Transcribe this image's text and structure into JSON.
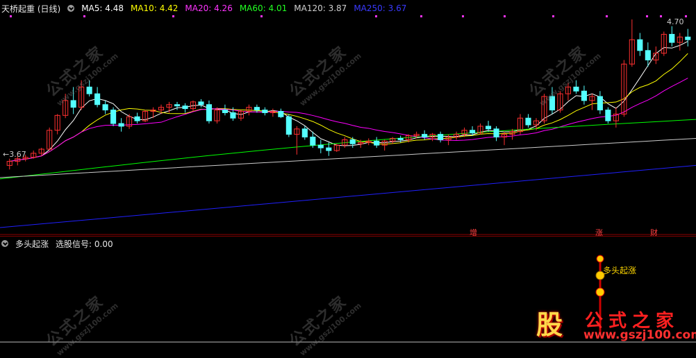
{
  "main_header": {
    "indicator_name": "天桥起重 (日线)",
    "ma5_label": "MA5:",
    "ma5_value": "4.48",
    "ma10_label": "MA10:",
    "ma10_value": "4.42",
    "ma20_label": "MA20:",
    "ma20_value": "4.26",
    "ma60_label": "MA60:",
    "ma60_value": "4.01",
    "ma120_label": "MA120:",
    "ma120_value": "3.87",
    "ma250_label": "MA250:",
    "ma250_value": "3.67"
  },
  "colors": {
    "ma5": "#ffffff",
    "ma10": "#ffff00",
    "ma20": "#ff00ff",
    "ma60": "#00ff00",
    "ma120": "#cccccc",
    "ma250": "#2020ff",
    "up": "#ff3030",
    "down": "#54ffff",
    "separator": "#8b0000",
    "marker": "#ff33ff"
  },
  "price_labels": {
    "high": "4.70",
    "low": "3.67"
  },
  "event_markers": [
    "增",
    "涨",
    "财"
  ],
  "sub_header": {
    "indicator_name": "多头起涨",
    "signal_label": "选股信号:",
    "signal_value": "0.00"
  },
  "signal_annotation": "多头起涨",
  "watermark": {
    "text": "公式之家",
    "url": "www.gszj100.com"
  },
  "brand": {
    "logo_char": "股",
    "name": "公式之家",
    "url": "www.gszj100.com"
  },
  "chart_data": {
    "type": "candlestick",
    "price_range": [
      3.2,
      4.75
    ],
    "candles": [
      [
        3.67,
        3.72,
        3.64,
        3.7
      ],
      [
        3.7,
        3.74,
        3.67,
        3.72
      ],
      [
        3.72,
        3.75,
        3.7,
        3.73
      ],
      [
        3.73,
        3.78,
        3.72,
        3.76
      ],
      [
        3.76,
        3.8,
        3.74,
        3.79
      ],
      [
        3.79,
        3.95,
        3.78,
        3.93
      ],
      [
        3.93,
        4.05,
        3.9,
        4.04
      ],
      [
        4.04,
        4.2,
        4.02,
        4.15
      ],
      [
        4.15,
        4.25,
        4.05,
        4.1
      ],
      [
        4.1,
        4.3,
        4.08,
        4.25
      ],
      [
        4.25,
        4.3,
        4.18,
        4.2
      ],
      [
        4.2,
        4.25,
        4.1,
        4.12
      ],
      [
        4.12,
        4.15,
        4.05,
        4.08
      ],
      [
        4.08,
        4.1,
        3.96,
        3.98
      ],
      [
        3.98,
        4.02,
        3.92,
        3.96
      ],
      [
        3.96,
        4.05,
        3.94,
        4.03
      ],
      [
        4.03,
        4.06,
        3.98,
        4.0
      ],
      [
        4.0,
        4.08,
        3.99,
        4.07
      ],
      [
        4.07,
        4.1,
        4.02,
        4.08
      ],
      [
        4.08,
        4.12,
        4.05,
        4.1
      ],
      [
        4.1,
        4.14,
        4.06,
        4.12
      ],
      [
        4.12,
        4.14,
        4.08,
        4.11
      ],
      [
        4.11,
        4.13,
        4.06,
        4.09
      ],
      [
        4.09,
        4.15,
        4.07,
        4.14
      ],
      [
        4.14,
        4.16,
        4.1,
        4.12
      ],
      [
        4.12,
        4.15,
        3.98,
        4.0
      ],
      [
        4.0,
        4.1,
        3.98,
        4.08
      ],
      [
        4.08,
        4.12,
        4.04,
        4.06
      ],
      [
        4.06,
        4.1,
        4.0,
        4.02
      ],
      [
        4.02,
        4.08,
        4.0,
        4.07
      ],
      [
        4.07,
        4.12,
        4.04,
        4.1
      ],
      [
        4.1,
        4.12,
        4.06,
        4.08
      ],
      [
        4.08,
        4.1,
        4.04,
        4.06
      ],
      [
        4.06,
        4.09,
        4.03,
        4.07
      ],
      [
        4.07,
        4.09,
        4.02,
        4.03
      ],
      [
        4.03,
        4.05,
        3.88,
        3.9
      ],
      [
        3.9,
        3.96,
        3.75,
        3.94
      ],
      [
        3.94,
        3.96,
        3.86,
        3.88
      ],
      [
        3.88,
        3.92,
        3.8,
        3.82
      ],
      [
        3.82,
        3.86,
        3.76,
        3.8
      ],
      [
        3.8,
        3.84,
        3.74,
        3.78
      ],
      [
        3.78,
        3.83,
        3.77,
        3.82
      ],
      [
        3.82,
        3.88,
        3.8,
        3.86
      ],
      [
        3.86,
        3.88,
        3.8,
        3.83
      ],
      [
        3.83,
        3.86,
        3.8,
        3.84
      ],
      [
        3.84,
        3.87,
        3.82,
        3.85
      ],
      [
        3.85,
        3.88,
        3.8,
        3.82
      ],
      [
        3.82,
        3.86,
        3.78,
        3.85
      ],
      [
        3.85,
        3.88,
        3.83,
        3.87
      ],
      [
        3.87,
        3.89,
        3.84,
        3.86
      ],
      [
        3.86,
        3.9,
        3.84,
        3.89
      ],
      [
        3.89,
        3.92,
        3.87,
        3.9
      ],
      [
        3.9,
        3.93,
        3.86,
        3.88
      ],
      [
        3.88,
        3.91,
        3.85,
        3.9
      ],
      [
        3.9,
        3.92,
        3.84,
        3.86
      ],
      [
        3.86,
        3.9,
        3.82,
        3.88
      ],
      [
        3.88,
        3.92,
        3.86,
        3.9
      ],
      [
        3.9,
        3.95,
        3.88,
        3.93
      ],
      [
        3.93,
        3.96,
        3.89,
        3.91
      ],
      [
        3.91,
        3.98,
        3.9,
        3.96
      ],
      [
        3.96,
        4.0,
        3.92,
        3.94
      ],
      [
        3.94,
        3.96,
        3.85,
        3.88
      ],
      [
        3.88,
        3.92,
        3.82,
        3.9
      ],
      [
        3.9,
        3.94,
        3.86,
        3.92
      ],
      [
        3.92,
        4.05,
        3.9,
        4.02
      ],
      [
        4.02,
        4.05,
        3.95,
        3.97
      ],
      [
        3.97,
        4.02,
        3.93,
        4.0
      ],
      [
        4.0,
        4.2,
        3.98,
        4.18
      ],
      [
        4.18,
        4.25,
        4.05,
        4.08
      ],
      [
        4.08,
        4.22,
        4.06,
        4.2
      ],
      [
        4.2,
        4.28,
        4.15,
        4.25
      ],
      [
        4.25,
        4.3,
        4.2,
        4.22
      ],
      [
        4.22,
        4.26,
        4.12,
        4.15
      ],
      [
        4.15,
        4.2,
        4.08,
        4.18
      ],
      [
        4.18,
        4.22,
        4.05,
        4.08
      ],
      [
        4.08,
        4.1,
        3.98,
        4.0
      ],
      [
        4.0,
        4.1,
        3.95,
        4.05
      ],
      [
        4.05,
        4.45,
        4.03,
        4.42
      ],
      [
        4.42,
        4.75,
        4.4,
        4.6
      ],
      [
        4.6,
        4.65,
        4.48,
        4.52
      ],
      [
        4.52,
        4.58,
        4.4,
        4.45
      ],
      [
        4.45,
        4.55,
        4.42,
        4.5
      ],
      [
        4.5,
        4.66,
        4.48,
        4.64
      ],
      [
        4.64,
        4.7,
        4.55,
        4.58
      ],
      [
        4.58,
        4.65,
        4.52,
        4.62
      ],
      [
        4.62,
        4.68,
        4.55,
        4.6
      ]
    ],
    "ma_series": [
      {
        "name": "MA5",
        "value": 4.48
      },
      {
        "name": "MA10",
        "value": 4.42
      },
      {
        "name": "MA20",
        "value": 4.26
      },
      {
        "name": "MA60",
        "value": 4.01
      },
      {
        "name": "MA120",
        "value": 3.87
      },
      {
        "name": "MA250",
        "value": 3.67
      }
    ]
  }
}
